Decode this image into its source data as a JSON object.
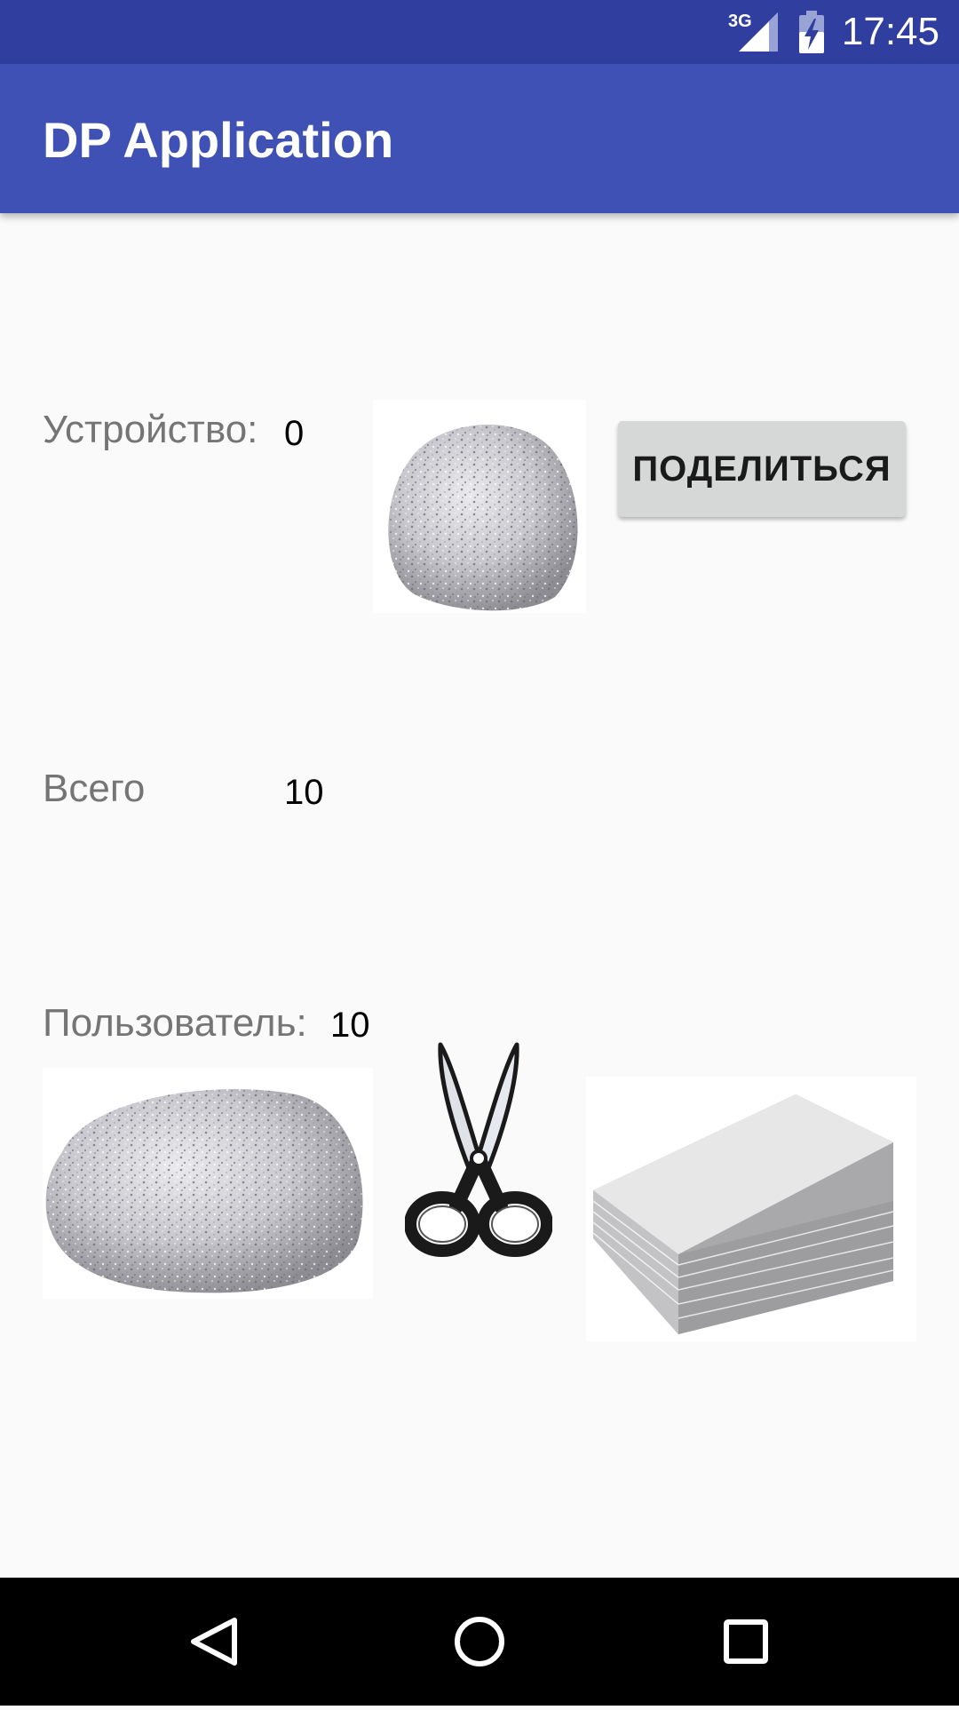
{
  "status_bar": {
    "network": "3G",
    "time": "17:45",
    "icons": [
      "signal-icon",
      "battery-charging-icon"
    ]
  },
  "app_bar": {
    "title": "DP Application"
  },
  "device_row": {
    "label": "Устройство:",
    "value": "0",
    "choice_icon": "rock-image",
    "share_button": "ПОДЕЛИТЬСЯ"
  },
  "total_row": {
    "label": "Всего",
    "value": "10"
  },
  "user_row": {
    "label": "Пользователь:",
    "value": "10",
    "choices": [
      "rock-image",
      "scissors-image",
      "paper-image"
    ]
  },
  "nav_bar": {
    "icons": [
      "back-icon",
      "home-icon",
      "recents-icon"
    ]
  },
  "colors": {
    "status_bar": "#303f9f",
    "app_bar": "#3f51b5",
    "background": "#fafafa",
    "button": "#d6d7d7",
    "nav_bar": "#000000"
  }
}
